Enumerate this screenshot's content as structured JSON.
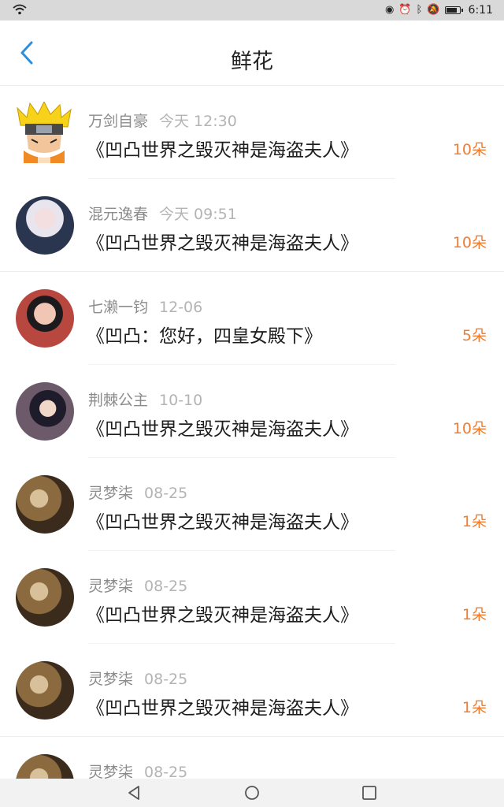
{
  "status_bar": {
    "time": "6:11",
    "icons": [
      "wifi-icon",
      "eye-icon",
      "alarm-icon",
      "bluetooth-icon",
      "mute-icon",
      "battery-icon"
    ],
    "battery_level": 0.9
  },
  "header": {
    "title": "鲜花",
    "back_icon": "chevron-left-icon",
    "accent_color": "#2b8fe0"
  },
  "list": {
    "count_color": "#f07d2f",
    "items": [
      {
        "name": "万剑自豪",
        "time": "今天 12:30",
        "book": "《凹凸世界之毁灭神是海盗夫人》",
        "count": "10朵"
      },
      {
        "name": "混元逸春",
        "time": "今天 09:51",
        "book": "《凹凸世界之毁灭神是海盗夫人》",
        "count": "10朵"
      },
      {
        "name": "七濑一钧",
        "time": "12-06",
        "book": "《凹凸：您好，四皇女殿下》",
        "count": "5朵"
      },
      {
        "name": "荆棘公主",
        "time": "10-10",
        "book": "《凹凸世界之毁灭神是海盗夫人》",
        "count": "10朵"
      },
      {
        "name": "灵梦柒",
        "time": "08-25",
        "book": "《凹凸世界之毁灭神是海盗夫人》",
        "count": "1朵"
      },
      {
        "name": "灵梦柒",
        "time": "08-25",
        "book": "《凹凸世界之毁灭神是海盗夫人》",
        "count": "1朵"
      },
      {
        "name": "灵梦柒",
        "time": "08-25",
        "book": "《凹凸世界之毁灭神是海盗夫人》",
        "count": "1朵"
      },
      {
        "name": "灵梦柒",
        "time": "08-25",
        "book": "",
        "count": ""
      }
    ]
  },
  "nav_bar": {
    "icons": [
      "back-triangle-icon",
      "home-circle-icon",
      "recents-square-icon"
    ]
  }
}
